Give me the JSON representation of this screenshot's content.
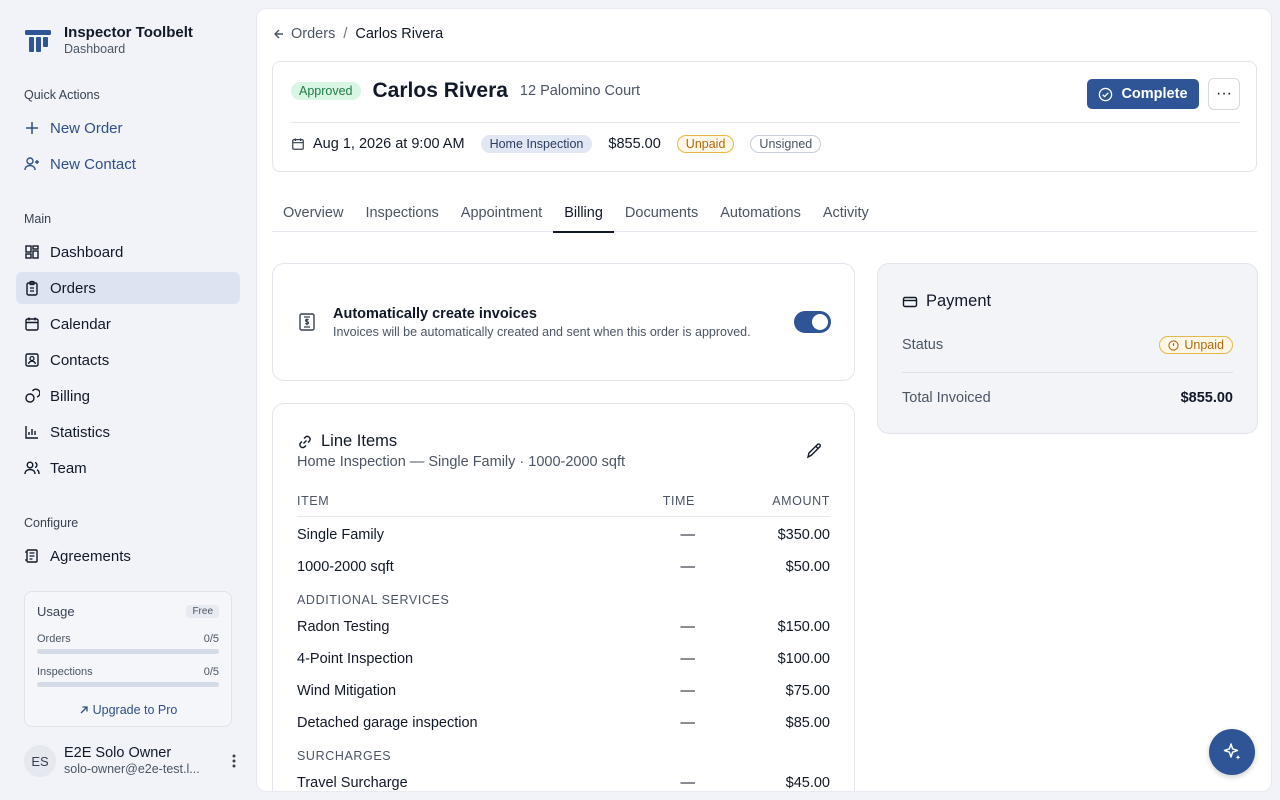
{
  "brand": {
    "title": "Inspector Toolbelt",
    "subtitle": "Dashboard",
    "icon": "toolbelt-logo-icon"
  },
  "sidebar": {
    "quick_actions_label": "Quick Actions",
    "quick_actions": [
      {
        "label": "New Order",
        "icon": "plus-icon"
      },
      {
        "label": "New Contact",
        "icon": "user-plus-icon"
      }
    ],
    "main_label": "Main",
    "main_items": [
      {
        "label": "Dashboard",
        "icon": "dashboard-grid-icon"
      },
      {
        "label": "Orders",
        "icon": "clipboard-icon",
        "active": true
      },
      {
        "label": "Calendar",
        "icon": "calendar-icon"
      },
      {
        "label": "Contacts",
        "icon": "contact-card-icon"
      },
      {
        "label": "Billing",
        "icon": "coins-icon"
      },
      {
        "label": "Statistics",
        "icon": "bar-chart-icon"
      },
      {
        "label": "Team",
        "icon": "users-icon"
      }
    ],
    "configure_label": "Configure",
    "configure_items": [
      {
        "label": "Agreements",
        "icon": "document-sign-icon"
      }
    ],
    "usage": {
      "title": "Usage",
      "plan_badge": "Free",
      "orders_label": "Orders",
      "orders_value": "0/5",
      "orders_progress": 0,
      "inspections_label": "Inspections",
      "inspections_value": "0/5",
      "inspections_progress": 0,
      "upgrade_label": "Upgrade to Pro"
    },
    "user": {
      "initials": "ES",
      "name": "E2E Solo Owner",
      "email": "solo-owner@e2e-test.l..."
    }
  },
  "breadcrumb": {
    "parent": "Orders",
    "separator": "/",
    "current": "Carlos Rivera"
  },
  "order": {
    "status": "Approved",
    "client_name": "Carlos Rivera",
    "address": "12 Palomino Court",
    "complete_label": "Complete",
    "more_label": "···",
    "date": "Aug 1, 2026 at 9:00 AM",
    "service_type": "Home Inspection",
    "price": "$855.00",
    "payment_badge": "Unpaid",
    "signature_badge": "Unsigned"
  },
  "tabs": [
    "Overview",
    "Inspections",
    "Appointment",
    "Billing",
    "Documents",
    "Automations",
    "Activity"
  ],
  "active_tab": "Billing",
  "auto_invoice": {
    "title": "Automatically create invoices",
    "description": "Invoices will be automatically created and sent when this order is approved.",
    "enabled": true
  },
  "line_items": {
    "title": "Line Items",
    "subtitle": "Home Inspection — Single Family · 1000-2000 sqft",
    "headers": {
      "item": "ITEM",
      "time": "TIME",
      "amount": "AMOUNT"
    },
    "rows": [
      {
        "item": "Single Family",
        "time": "—",
        "amount": "$350.00"
      },
      {
        "item": "1000-2000 sqft",
        "time": "—",
        "amount": "$50.00"
      }
    ],
    "additional_label": "ADDITIONAL SERVICES",
    "additional_rows": [
      {
        "item": "Radon Testing",
        "time": "—",
        "amount": "$150.00"
      },
      {
        "item": "4-Point Inspection",
        "time": "—",
        "amount": "$100.00"
      },
      {
        "item": "Wind Mitigation",
        "time": "—",
        "amount": "$75.00"
      },
      {
        "item": "Detached garage inspection",
        "time": "—",
        "amount": "$85.00"
      }
    ],
    "surcharges_label": "SURCHARGES",
    "surcharge_rows": [
      {
        "item": "Travel Surcharge",
        "time": "—",
        "amount": "$45.00"
      }
    ]
  },
  "payment": {
    "title": "Payment",
    "status_label": "Status",
    "status_value": "Unpaid",
    "total_label": "Total Invoiced",
    "total_value": "$855.00"
  },
  "colors": {
    "accent": "#2f5597",
    "active_nav_bg": "#dde4f1",
    "approved_bg": "#d9f5e4",
    "unpaid_border": "#e6b84c"
  }
}
